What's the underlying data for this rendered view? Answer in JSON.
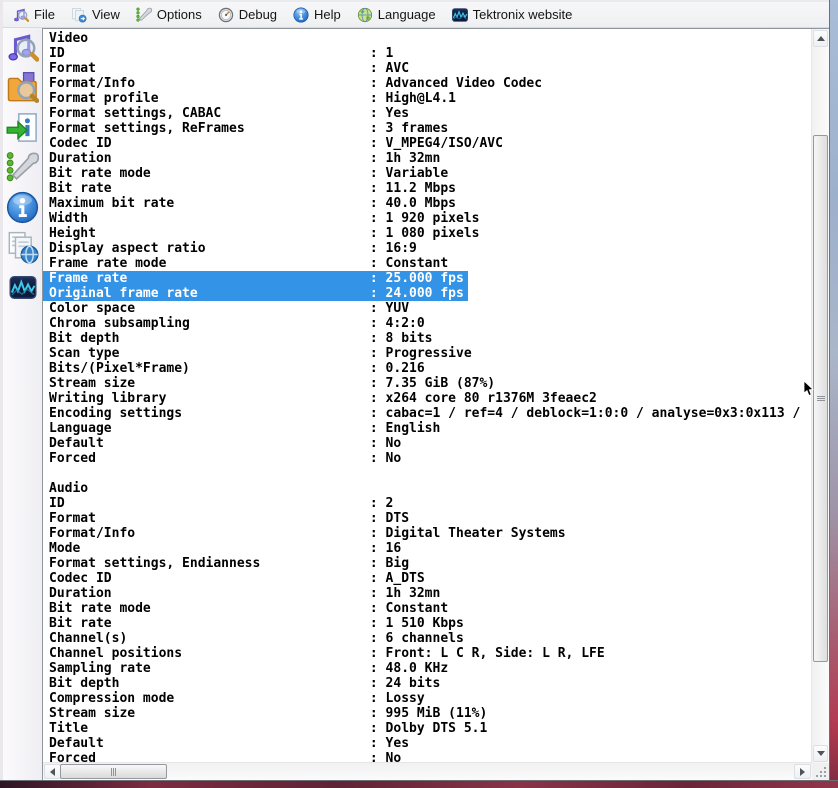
{
  "menu": {
    "items": [
      {
        "label": "File",
        "icon": "file-open-icon"
      },
      {
        "label": "View",
        "icon": "view-icon"
      },
      {
        "label": "Options",
        "icon": "options-wrench-icon"
      },
      {
        "label": "Debug",
        "icon": "debug-gauge-icon"
      },
      {
        "label": "Help",
        "icon": "help-info-icon"
      },
      {
        "label": "Language",
        "icon": "language-globe-icon"
      },
      {
        "label": "Tektronix website",
        "icon": "tektronix-icon"
      }
    ]
  },
  "toolbar": {
    "buttons": [
      {
        "name": "open-file-button",
        "icon": "file-open-icon"
      },
      {
        "name": "open-folder-button",
        "icon": "folder-open-icon"
      },
      {
        "name": "export-info-button",
        "icon": "export-info-icon"
      },
      {
        "name": "preferences-button",
        "icon": "options-wrench-icon"
      },
      {
        "name": "about-button",
        "icon": "help-info-icon"
      },
      {
        "name": "export-web-button",
        "icon": "export-web-icon"
      },
      {
        "name": "tektronix-button",
        "icon": "tektronix-icon"
      }
    ]
  },
  "report": {
    "sections": [
      {
        "title": "Video",
        "rows": [
          {
            "label": "ID",
            "value": "1"
          },
          {
            "label": "Format",
            "value": "AVC"
          },
          {
            "label": "Format/Info",
            "value": "Advanced Video Codec"
          },
          {
            "label": "Format profile",
            "value": "High@L4.1"
          },
          {
            "label": "Format settings, CABAC",
            "value": "Yes"
          },
          {
            "label": "Format settings, ReFrames",
            "value": "3 frames"
          },
          {
            "label": "Codec ID",
            "value": "V_MPEG4/ISO/AVC"
          },
          {
            "label": "Duration",
            "value": "1h 32mn"
          },
          {
            "label": "Bit rate mode",
            "value": "Variable"
          },
          {
            "label": "Bit rate",
            "value": "11.2 Mbps"
          },
          {
            "label": "Maximum bit rate",
            "value": "40.0 Mbps"
          },
          {
            "label": "Width",
            "value": "1 920 pixels"
          },
          {
            "label": "Height",
            "value": "1 080 pixels"
          },
          {
            "label": "Display aspect ratio",
            "value": "16:9"
          },
          {
            "label": "Frame rate mode",
            "value": "Constant"
          },
          {
            "label": "Frame rate",
            "value": "25.000 fps",
            "selected": true
          },
          {
            "label": "Original frame rate",
            "value": "24.000 fps",
            "selected": true
          },
          {
            "label": "Color space",
            "value": "YUV"
          },
          {
            "label": "Chroma subsampling",
            "value": "4:2:0"
          },
          {
            "label": "Bit depth",
            "value": "8 bits"
          },
          {
            "label": "Scan type",
            "value": "Progressive"
          },
          {
            "label": "Bits/(Pixel*Frame)",
            "value": "0.216"
          },
          {
            "label": "Stream size",
            "value": "7.35 GiB (87%)"
          },
          {
            "label": "Writing library",
            "value": "x264 core 80 r1376M 3feaec2"
          },
          {
            "label": "Encoding settings",
            "value": "cabac=1 / ref=4 / deblock=1:0:0 / analyse=0x3:0x113 / "
          },
          {
            "label": "Language",
            "value": "English"
          },
          {
            "label": "Default",
            "value": "No"
          },
          {
            "label": "Forced",
            "value": "No"
          }
        ]
      },
      {
        "title": "Audio",
        "rows": [
          {
            "label": "ID",
            "value": "2"
          },
          {
            "label": "Format",
            "value": "DTS"
          },
          {
            "label": "Format/Info",
            "value": "Digital Theater Systems"
          },
          {
            "label": "Mode",
            "value": "16"
          },
          {
            "label": "Format settings, Endianness",
            "value": "Big"
          },
          {
            "label": "Codec ID",
            "value": "A_DTS"
          },
          {
            "label": "Duration",
            "value": "1h 32mn"
          },
          {
            "label": "Bit rate mode",
            "value": "Constant"
          },
          {
            "label": "Bit rate",
            "value": "1 510 Kbps"
          },
          {
            "label": "Channel(s)",
            "value": "6 channels"
          },
          {
            "label": "Channel positions",
            "value": "Front: L C R, Side: L R, LFE"
          },
          {
            "label": "Sampling rate",
            "value": "48.0 KHz"
          },
          {
            "label": "Bit depth",
            "value": "24 bits"
          },
          {
            "label": "Compression mode",
            "value": "Lossy"
          },
          {
            "label": "Stream size",
            "value": "995 MiB (11%)"
          },
          {
            "label": "Title",
            "value": "Dolby DTS 5.1"
          },
          {
            "label": "Default",
            "value": "Yes"
          },
          {
            "label": "Forced",
            "value": "No"
          }
        ]
      }
    ]
  },
  "colors": {
    "selection": "#3293e7",
    "selection_text": "#ffffff",
    "report_background": "#ffffff",
    "report_text": "#000000"
  }
}
